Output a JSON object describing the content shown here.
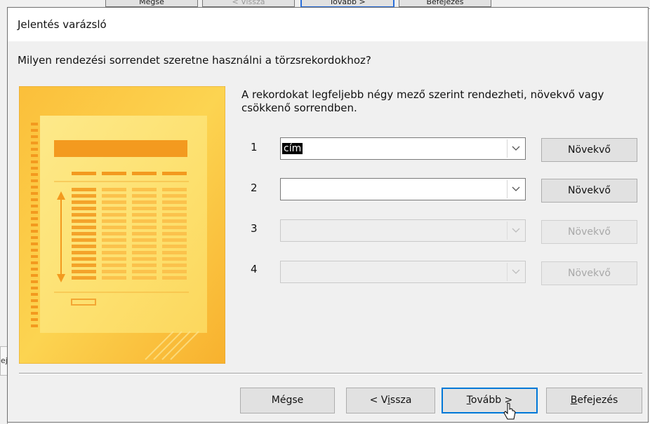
{
  "background_window": {
    "buttons": [
      "Mégse",
      "< Vissza",
      "Tovább >",
      "Befejezés"
    ],
    "side_text": "ej"
  },
  "dialog": {
    "title": "Jelentés varázsló",
    "question": "Milyen rendezési sorrendet szeretne használni a törzsrekordokhoz?",
    "description": "A rekordokat legfeljebb négy mező szerint rendezheti, növekvő vagy csökkenő sorrendben.",
    "sort_rows": [
      {
        "number": "1",
        "value": "cím",
        "button": "Növekvő",
        "enabled": true
      },
      {
        "number": "2",
        "value": "",
        "button": "Növekvő",
        "enabled": true
      },
      {
        "number": "3",
        "value": "",
        "button": "Növekvő",
        "enabled": false
      },
      {
        "number": "4",
        "value": "",
        "button": "Növekvő",
        "enabled": false
      }
    ],
    "footer": {
      "cancel": "Mégse",
      "back_prefix": "< V",
      "back_key": "i",
      "back_suffix": "ssza",
      "next_key": "T",
      "next_rest": "ovább >",
      "finish_key": "B",
      "finish_rest": "efejezés"
    }
  },
  "colors": {
    "dialog_bg": "#f0f0f0",
    "illustration_orange": "#f7a829",
    "illustration_yellow": "#fde67a",
    "default_button_border": "#0078d7"
  }
}
